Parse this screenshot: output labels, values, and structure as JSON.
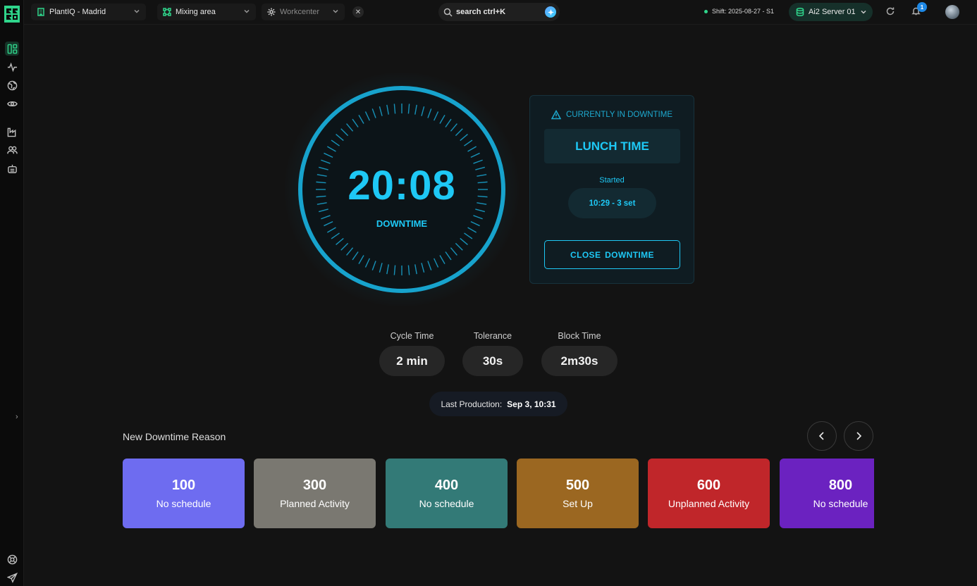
{
  "topbar": {
    "plant": "PlantIQ - Madrid",
    "area": "Mixing area",
    "workcenter_placeholder": "Workcenter",
    "clear_glyph": "✕",
    "search_label": "search ctrl+K",
    "shift": "Shift: 2025-08-27 - S1",
    "server": "Ai2 Server 01",
    "notification_count": "1"
  },
  "sidebar": {
    "icons": [
      "dashboard-icon",
      "activity-icon",
      "globe-icon",
      "eye-icon",
      "factory-icon",
      "users-icon",
      "robot-icon",
      "support-icon",
      "send-icon"
    ],
    "expand_glyph": "›"
  },
  "timer": {
    "value": "20:08",
    "label": "DOWNTIME"
  },
  "downtime_panel": {
    "header": "CURRENTLY IN DOWNTIME",
    "reason": "LUNCH TIME",
    "started_label": "Started",
    "started_value": "10:29 - 3 set",
    "close_button": "CLOSE  DOWNTIME"
  },
  "metrics": [
    {
      "label": "Cycle Time",
      "value": "2 min"
    },
    {
      "label": "Tolerance",
      "value": "30s"
    },
    {
      "label": "Block Time",
      "value": "2m30s"
    }
  ],
  "last_production": {
    "label": "Last Production:",
    "value": "Sep 3, 10:31"
  },
  "reasons": {
    "title": "New Downtime Reason",
    "items": [
      {
        "code": "100",
        "name": "No schedule",
        "color": "#6e6cf0"
      },
      {
        "code": "300",
        "name": "Planned Activity",
        "color": "#7a7871"
      },
      {
        "code": "400",
        "name": "No schedule",
        "color": "#337a77"
      },
      {
        "code": "500",
        "name": "Set Up",
        "color": "#9b6721"
      },
      {
        "code": "600",
        "name": "Unplanned Activity",
        "color": "#c0262a"
      },
      {
        "code": "800",
        "name": "No schedule",
        "color": "#6b22c0"
      }
    ]
  },
  "colors": {
    "accent": "#1ec8f5",
    "brand_green": "#2fd58b"
  }
}
